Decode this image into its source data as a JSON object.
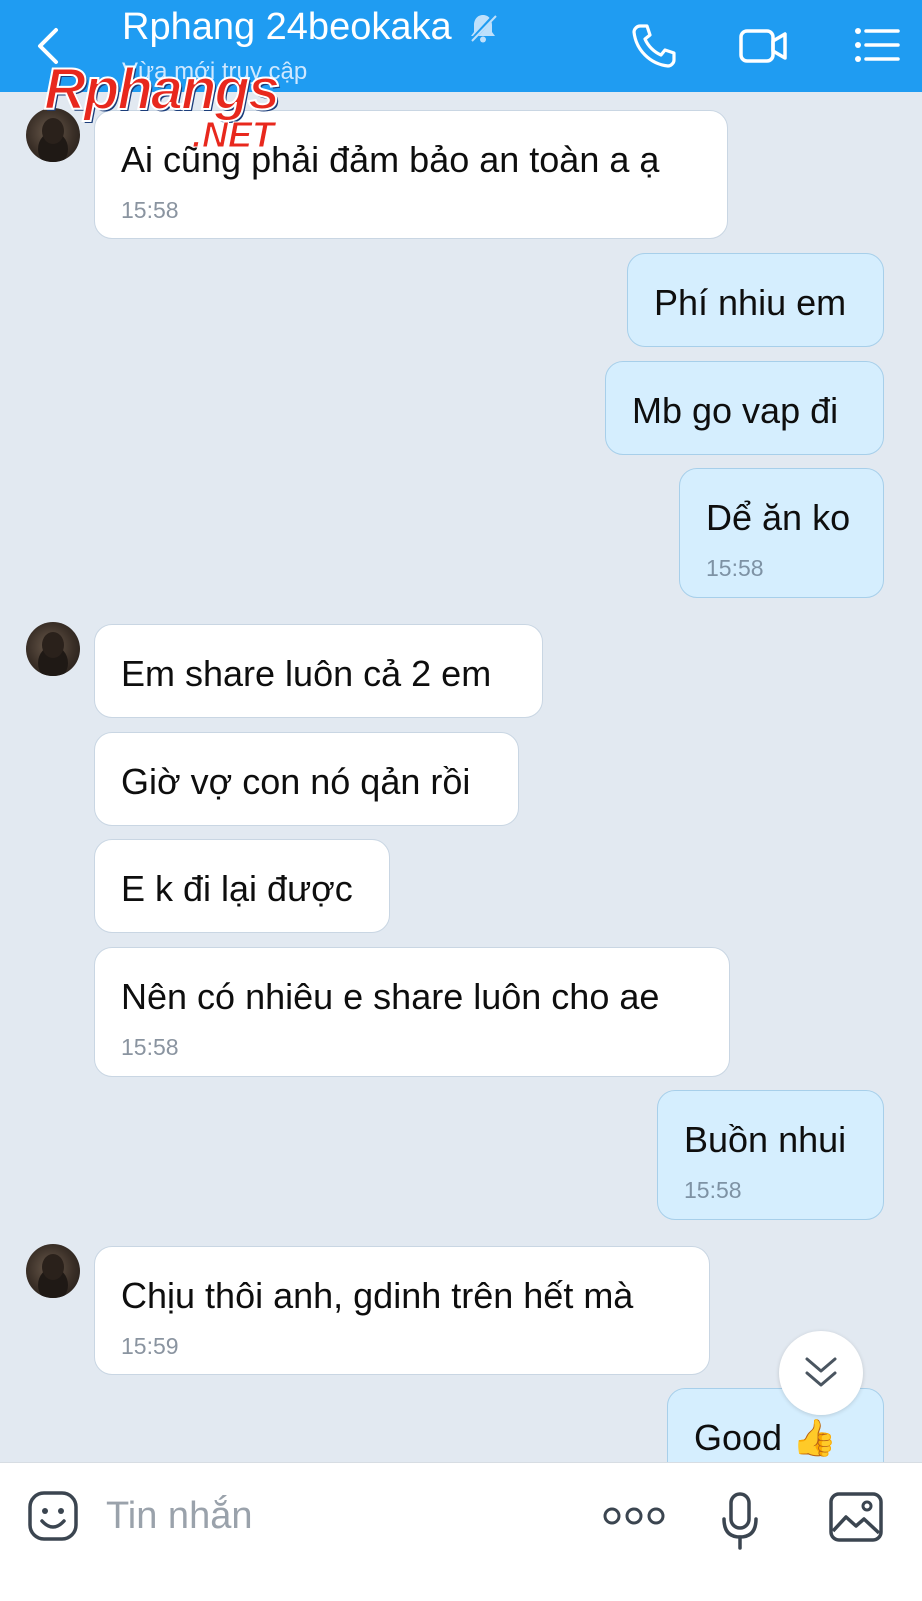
{
  "header": {
    "title": "Rphang 24beokaka",
    "subtitle": "Vừa mới truy cập",
    "back_icon": "chevron-left-icon",
    "mute_icon": "bell-off-icon",
    "call_icon": "phone-icon",
    "video_icon": "video-camera-icon",
    "menu_icon": "list-menu-icon",
    "background_color": "#1f9cf2"
  },
  "watermark": {
    "main": "Rphangs",
    "suffix": ".NET"
  },
  "messages": [
    {
      "side": "in",
      "text": "Ai cũng phải đảm bảo an toàn a ạ",
      "time": "15:58",
      "avatar": true
    },
    {
      "side": "out",
      "text": "Phí nhiu em"
    },
    {
      "side": "out",
      "text": "Mb go vap đi"
    },
    {
      "side": "out",
      "text": "Dể ăn ko",
      "time": "15:58"
    },
    {
      "side": "in",
      "text": "Em share luôn cả 2 em",
      "avatar": true
    },
    {
      "side": "in",
      "text": "Giờ vợ con nó qản rồi"
    },
    {
      "side": "in",
      "text": "E k đi lại được"
    },
    {
      "side": "in",
      "text": "Nên có nhiêu e share luôn cho ae",
      "time": "15:58"
    },
    {
      "side": "out",
      "text": "Buồn nhui",
      "time": "15:58"
    },
    {
      "side": "in",
      "text": "Chịu thôi anh, gdinh trên hết mà",
      "time": "15:59",
      "avatar": true
    },
    {
      "side": "out",
      "text": "Good 👍"
    }
  ],
  "scroll_button_icon": "double-chevron-down-icon",
  "composer": {
    "placeholder": "Tin nhắn",
    "emoji_icon": "emoji-icon",
    "more_icon": "more-dots-icon",
    "mic_icon": "microphone-icon",
    "image_icon": "image-icon"
  },
  "colors": {
    "chat_background": "#e2e9f1",
    "incoming_bubble": "#ffffff",
    "outgoing_bubble": "#d5eefe"
  }
}
